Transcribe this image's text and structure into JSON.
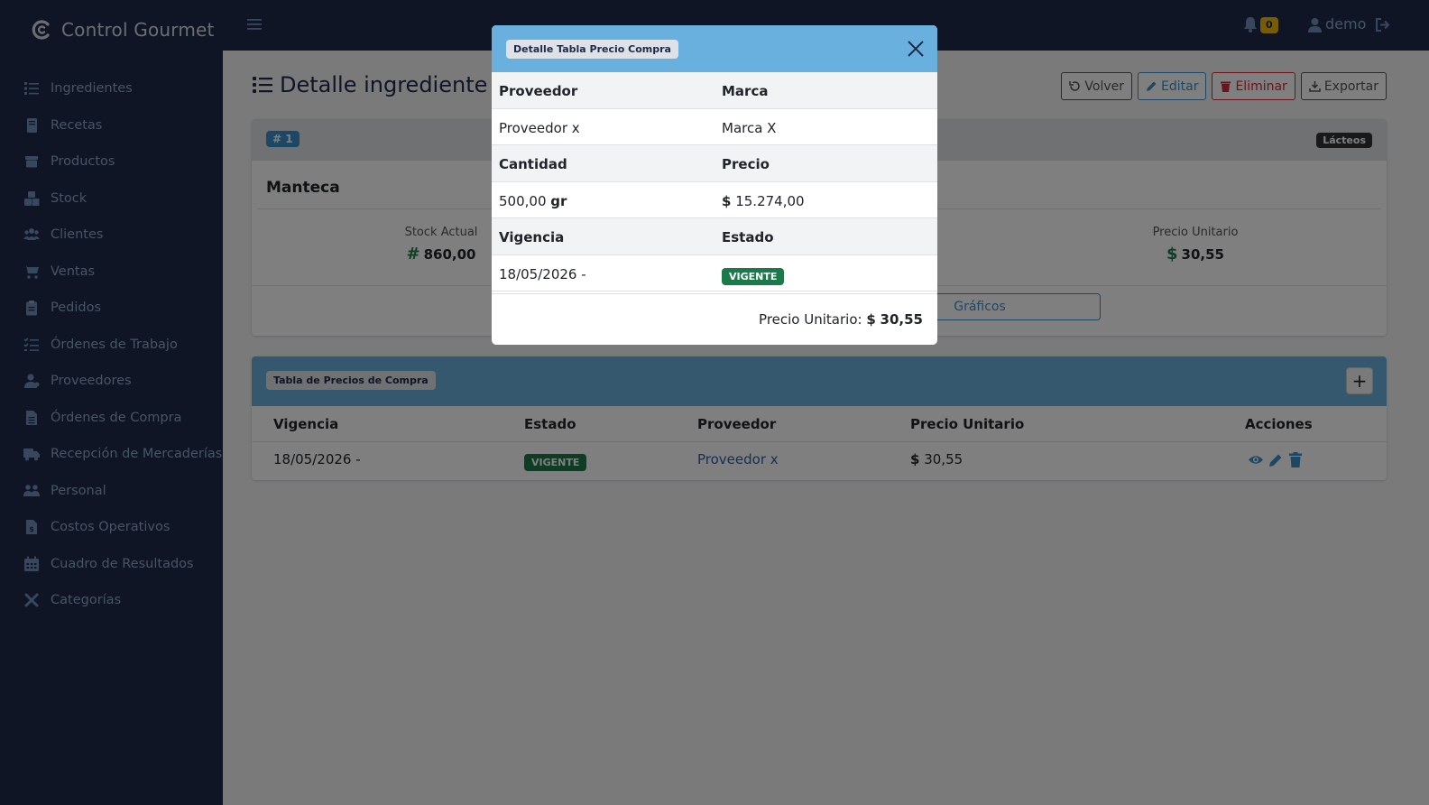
{
  "brand": {
    "name": "Control Gourmet",
    "logo_icon": "c-logo-icon"
  },
  "sidebar": {
    "items": [
      {
        "label": "Ingredientes",
        "icon": "list-icon"
      },
      {
        "label": "Recetas",
        "icon": "book-icon"
      },
      {
        "label": "Productos",
        "icon": "box-icon"
      },
      {
        "label": "Stock",
        "icon": "boxes-icon"
      },
      {
        "label": "Clientes",
        "icon": "users-icon"
      },
      {
        "label": "Ventas",
        "icon": "cart-icon"
      },
      {
        "label": "Pedidos",
        "icon": "clipboard-icon"
      },
      {
        "label": "Órdenes de Trabajo",
        "icon": "tasks-icon"
      },
      {
        "label": "Proveedores",
        "icon": "user-tie-icon"
      },
      {
        "label": "Órdenes de Compra",
        "icon": "file-icon"
      },
      {
        "label": "Recepción de Mercaderías",
        "icon": "truck-icon"
      },
      {
        "label": "Personal",
        "icon": "people-icon"
      },
      {
        "label": "Costos Operativos",
        "icon": "invoice-icon"
      },
      {
        "label": "Cuadro de Resultados",
        "icon": "calendar-icon"
      },
      {
        "label": "Categorías",
        "icon": "tools-icon"
      }
    ]
  },
  "topbar": {
    "notifications": "0",
    "user": "demo"
  },
  "page": {
    "title": "Detalle ingrediente",
    "actions": {
      "volver": "Volver",
      "editar": "Editar",
      "eliminar": "Eliminar",
      "exportar": "Exportar"
    }
  },
  "ingredient": {
    "id_badge": "# 1",
    "category": "Lácteos",
    "name": "Manteca",
    "stock_label": "Stock Actual",
    "stock_symbol": "#",
    "stock_value": "860,00",
    "price_label": "Precio Unitario",
    "price_symbol": "$",
    "price_value": "30,55",
    "charts_button": "Gráficos"
  },
  "price_table": {
    "title": "Tabla de Precios de Compra",
    "add_label": "+",
    "headers": [
      "Vigencia",
      "Estado",
      "Proveedor",
      "Precio Unitario",
      "Acciones"
    ],
    "rows": [
      {
        "vigencia": "18/05/2026 -",
        "estado": "VIGENTE",
        "proveedor": "Proveedor x",
        "precio_symbol": "$",
        "precio": "30,55"
      }
    ]
  },
  "modal": {
    "title": "Detalle Tabla Precio Compra",
    "rows": [
      {
        "c1": "Proveedor",
        "c2": "Marca",
        "header": true
      },
      {
        "c1": "Proveedor x",
        "c2": "Marca X"
      },
      {
        "c1": "Cantidad",
        "c2": "Precio",
        "header": true
      },
      {
        "c1_value": "500,00",
        "c1_unit": "gr",
        "c2_symbol": "$",
        "c2_value": "15.274,00"
      },
      {
        "c1": "Vigencia",
        "c2": "Estado",
        "header": true
      },
      {
        "c1": "18/05/2026 -",
        "c2_badge": "VIGENTE"
      }
    ],
    "footer_label": "Precio Unitario:",
    "footer_symbol": "$",
    "footer_value": "30,55"
  }
}
